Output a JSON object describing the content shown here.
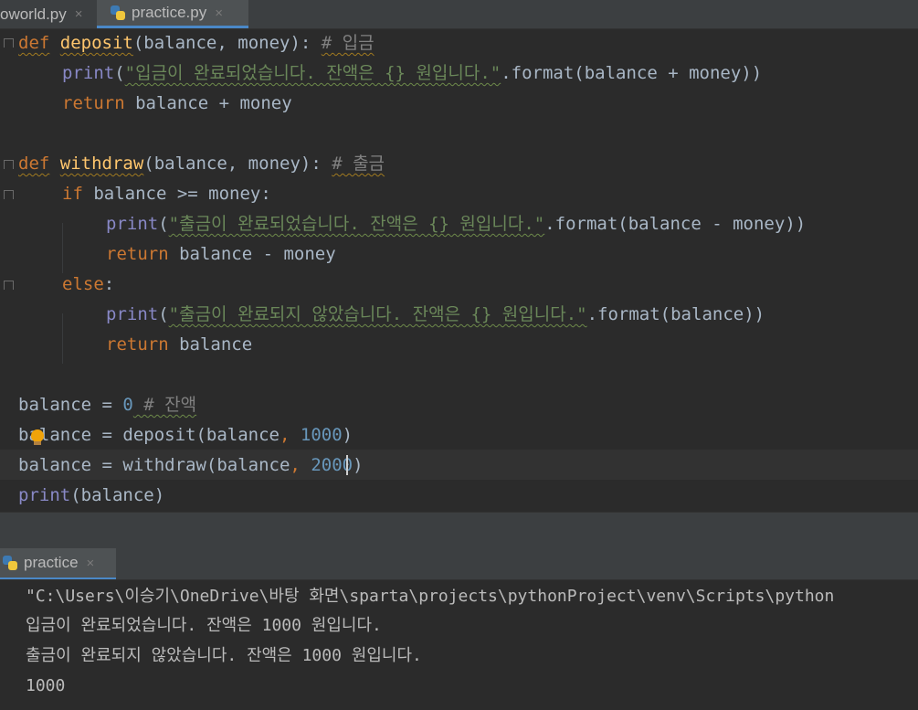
{
  "tabs": [
    {
      "label": "oworld.py",
      "close": "×"
    },
    {
      "label": "practice.py",
      "close": "×"
    }
  ],
  "code": {
    "l1": {
      "kw": "def",
      "fn": "deposit",
      "rest": "(balance, money): ",
      "cm": "# 입금"
    },
    "l2": {
      "fn": "print",
      "p1": "(",
      "str": "\"입금이 완료되었습니다. 잔액은 {} 원입니다.\"",
      "rest": ".format(balance + money))"
    },
    "l3": {
      "kw": "return",
      "rest": " balance + money"
    },
    "l5": {
      "kw": "def",
      "fn": "withdraw",
      "rest": "(balance, money): ",
      "cm": "# 출금"
    },
    "l6": {
      "kw": "if",
      "rest": " balance >= money:"
    },
    "l7": {
      "fn": "print",
      "p1": "(",
      "str": "\"출금이 완료되었습니다. 잔액은 {} 원입니다.\"",
      "rest": ".format(balance - money))"
    },
    "l8": {
      "kw": "return",
      "rest": " balance - money"
    },
    "l9": {
      "kw": "else",
      "rest": ":"
    },
    "l10": {
      "fn": "print",
      "p1": "(",
      "str": "\"출금이 완료되지 않았습니다. 잔액은 {} 원입니다.\"",
      "rest": ".format(balance))"
    },
    "l11": {
      "kw": "return",
      "rest": " balance"
    },
    "l13": {
      "a": "balance = ",
      "num": "0",
      "cm": " # 잔액"
    },
    "l14": {
      "a": "balance = deposit(balance",
      "comma": ", ",
      "num": "1000",
      "b": ")"
    },
    "l15": {
      "a": "balance = withdraw(balance",
      "comma": ", ",
      "num": "2000",
      "b": ")"
    },
    "l16": {
      "fn": "print",
      "rest": "(balance)"
    }
  },
  "run": {
    "tab_label": "practice",
    "close": "×",
    "lines": [
      "\"C:\\Users\\이승기\\OneDrive\\바탕 화면\\sparta\\projects\\pythonProject\\venv\\Scripts\\python",
      "입금이 완료되었습니다. 잔액은 1000 원입니다.",
      "출금이 완료되지 않았습니다. 잔액은 1000 원입니다.",
      "1000"
    ]
  },
  "icons": [
    "python-file-icon",
    "fold-icon",
    "intention-bulb-icon",
    "close-icon"
  ],
  "colors": {
    "keyword": "#cc7832",
    "function": "#ffc66d",
    "string": "#6a8759",
    "number": "#6897bb",
    "comment": "#808080",
    "background": "#2b2b2b"
  }
}
